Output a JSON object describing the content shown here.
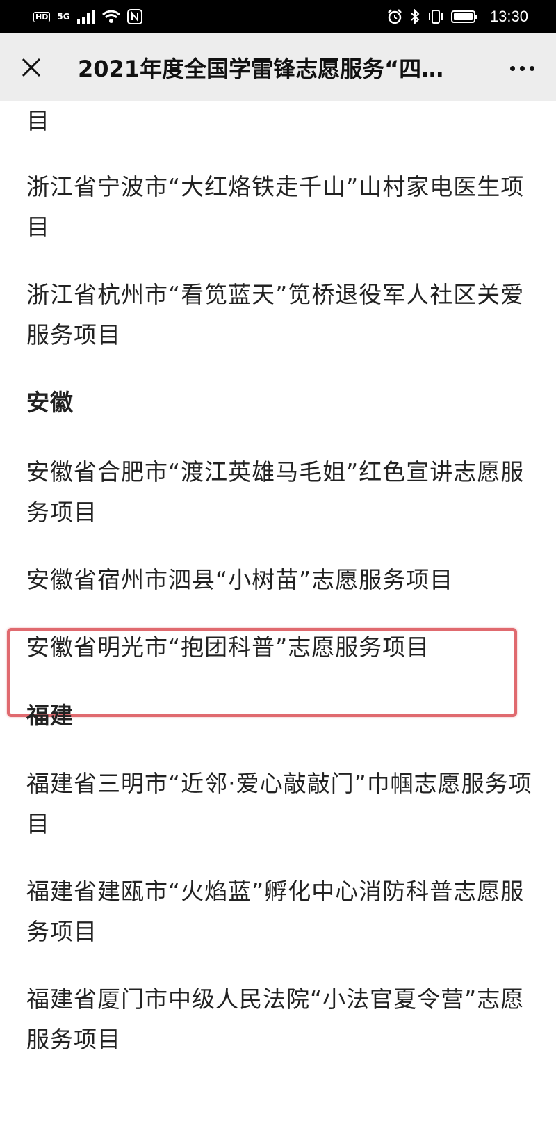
{
  "status_bar": {
    "hd_badge": "HD",
    "network": "5G",
    "time": "13:30"
  },
  "nav": {
    "title": "2021年度全国学雷锋志愿服务“四…"
  },
  "article": {
    "fragment": "目",
    "items": [
      "浙江省宁波市“大红烙铁走千山”山村家电医生项目",
      "浙江省杭州市“看笕蓝天”笕桥退役军人社区关爱服务项目"
    ],
    "anhui_heading": "安徽",
    "anhui_items": [
      "安徽省合肥市“渡江英雄马毛姐”红色宣讲志愿服务项目",
      "安徽省宿州市泗县“小树苗”志愿服务项目",
      "安徽省明光市“抱团科普”志愿服务项目"
    ],
    "fujian_heading": "福建",
    "fujian_items": [
      "福建省三明市“近邻·爱心敲敲门”巾帼志愿服务项目",
      "福建省建瓯市“火焰蓝”孵化中心消防科普志愿服务项目",
      "福建省厦门市中级人民法院“小法官夏令营”志愿服务项目"
    ]
  },
  "colors": {
    "highlight_border": "#e06a6f",
    "nav_background": "#ededed"
  }
}
